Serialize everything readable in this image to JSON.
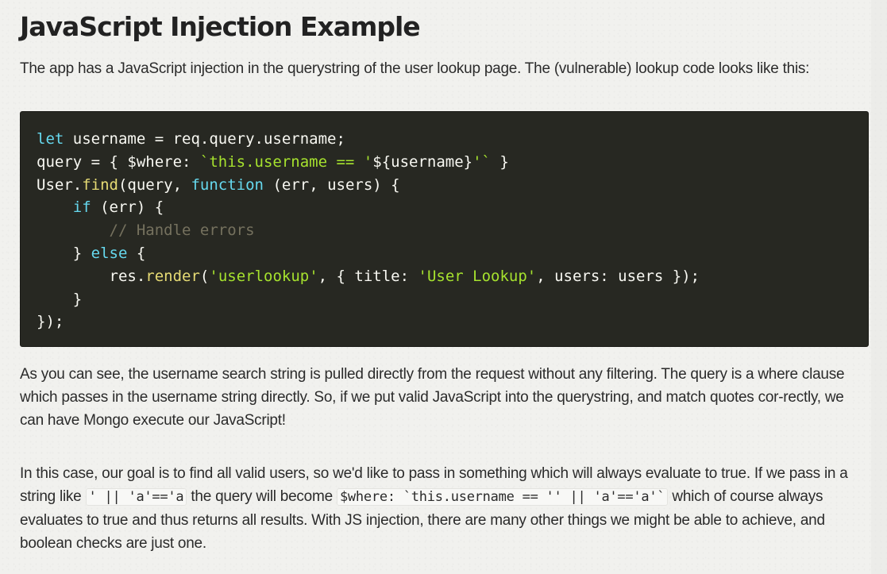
{
  "heading": "JavaScript Injection Example",
  "intro": "The app has a JavaScript injection in the querystring of the user lookup page. The (vulnerable) lookup code looks like this:",
  "code": {
    "line1": {
      "kw": "let",
      "rest": " username = req.query.username;"
    },
    "line2": {
      "pre": "query = { $where: ",
      "str1": "`this.username == '",
      "mid": "${username}",
      "str2": "'`",
      "post": " }"
    },
    "line3": {
      "obj": "User.",
      "fn": "find",
      "mid": "(query, ",
      "kw": "function",
      "post": " (err, users) {"
    },
    "line4": {
      "indent": "    ",
      "kw": "if",
      "post": " (err) {"
    },
    "line5": {
      "indent": "        ",
      "comment": "// Handle errors"
    },
    "line6": {
      "indent": "    ",
      "pre": "} ",
      "kw": "else",
      "post": " {"
    },
    "line7": {
      "indent": "        ",
      "obj": "res.",
      "fn": "render",
      "a": "(",
      "str1": "'userlookup'",
      "b": ", { title: ",
      "str2": "'User Lookup'",
      "c": ", users: users });"
    },
    "line8": {
      "text": "    }"
    },
    "line9": {
      "text": "});"
    }
  },
  "para2": "As you can see, the username search string is pulled directly from the request without any filtering. The query is a where clause which passes in the username string directly. So, if we put valid JavaScript into the querystring, and match quotes cor-rectly, we can have Mongo execute our JavaScript!",
  "para3": {
    "t1": "In this case, our goal is to find all valid users, so we'd like to pass in something which will always evaluate to true. If we pass in a string like ",
    "code1": "' || 'a'=='a",
    "t2": " the query will become ",
    "code2": "$where: `this.username == '' || 'a'=='a'`",
    "t3": " which of course always evaluates to true and thus returns all results. With JS injection, there are many other things we might be able to achieve, and boolean checks are just one."
  }
}
